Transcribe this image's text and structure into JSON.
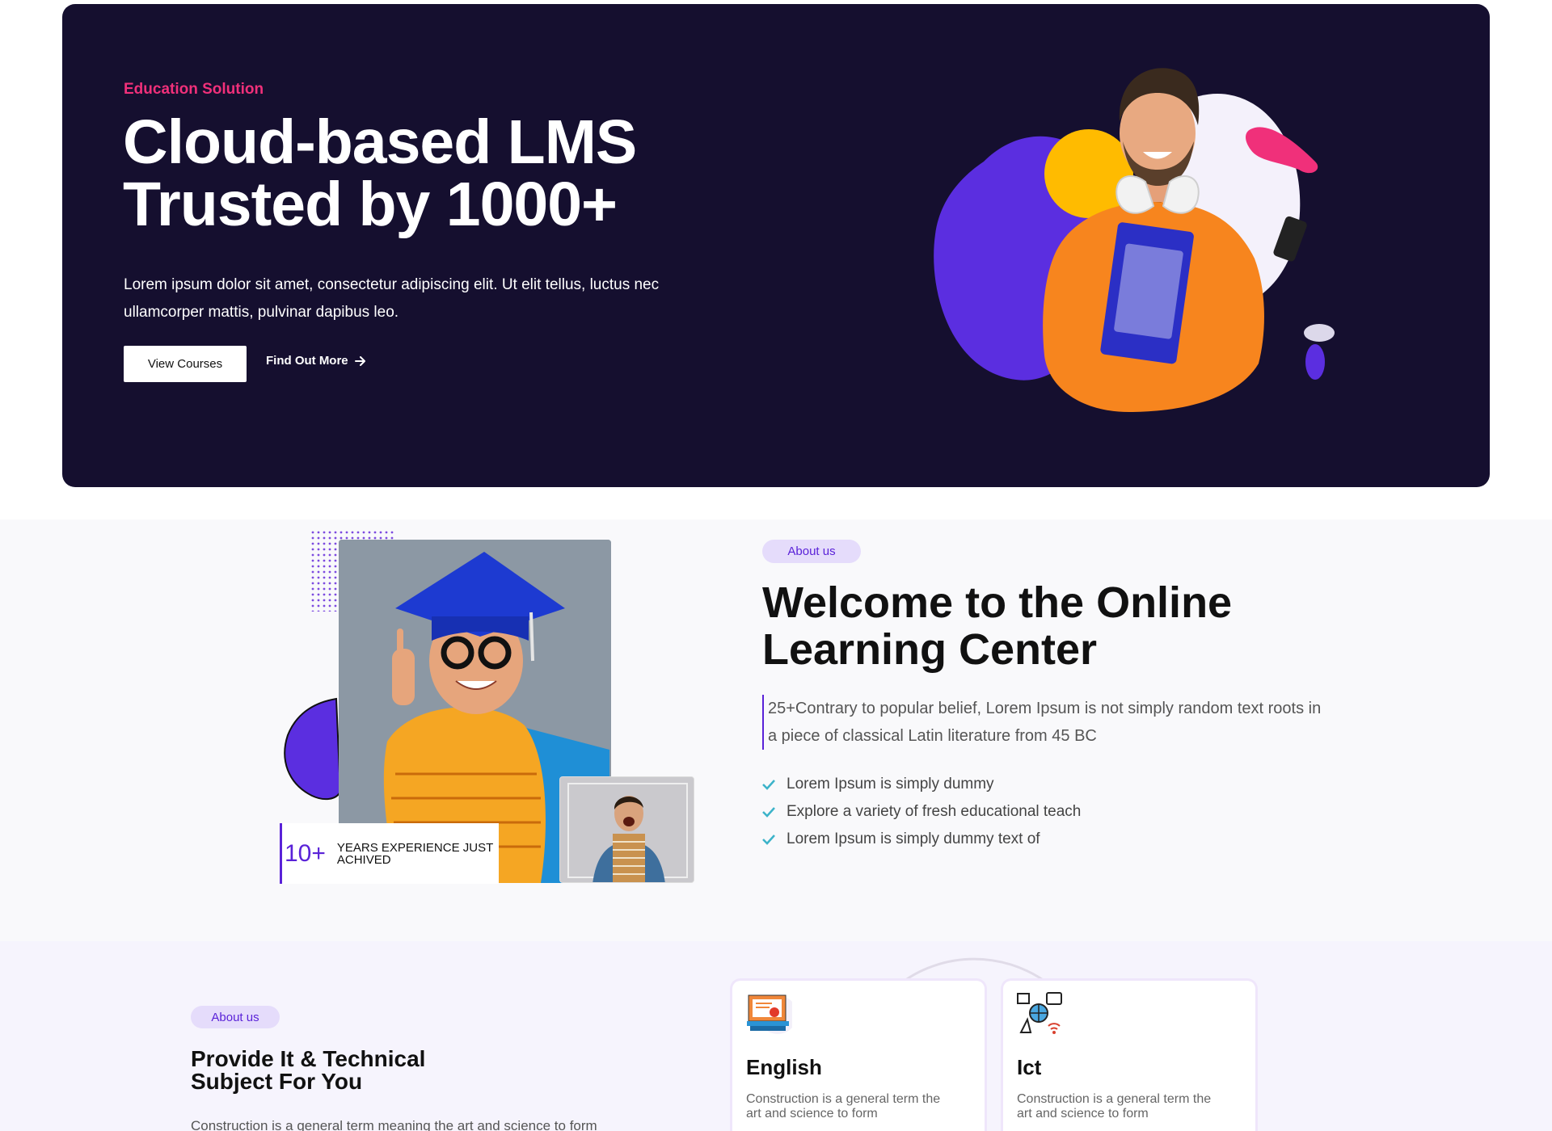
{
  "hero": {
    "eyebrow": "Education Solution",
    "title_line1": "Cloud-based LMS",
    "title_line2": "Trusted by 1000+",
    "description": "Lorem ipsum dolor sit amet, consectetur adipiscing elit. Ut elit tellus, luctus nec ullamcorper mattis, pulvinar dapibus leo.",
    "primary_button": "View Courses",
    "secondary_link": "Find Out More",
    "secondary_icon": "arrow-right-icon",
    "colors": {
      "background": "#150f2f",
      "accent": "#f0307a",
      "purple": "#5b2ee0",
      "yellow": "#ffbb00"
    }
  },
  "about": {
    "badge": "About us",
    "title_line1": "Welcome to the Online",
    "title_line2": "Learning Center",
    "quote": "25+Contrary to popular belief, Lorem Ipsum is not simply random text roots in a piece of classical Latin literature from 45 BC",
    "list": [
      "Lorem Ipsum is simply dummy",
      "Explore a variety of fresh educational teach",
      "Lorem Ipsum is simply dummy text of"
    ],
    "experience": {
      "number": "10+",
      "label": "Years Experience Just Achived"
    },
    "colors": {
      "accent": "#5a22d8",
      "check": "#3cb3c9"
    }
  },
  "subjects": {
    "badge": "About us",
    "title_line1": "Provide It & Technical",
    "title_line2": "Subject For You",
    "description": "Construction is a general term meaning the art and science to form",
    "cards": [
      {
        "icon": "certificate-icon",
        "title": "English",
        "text": "Construction is a general term the art and science to form"
      },
      {
        "icon": "network-icon",
        "title": "Ict",
        "text": "Construction is a general term the art and science to form"
      }
    ]
  }
}
